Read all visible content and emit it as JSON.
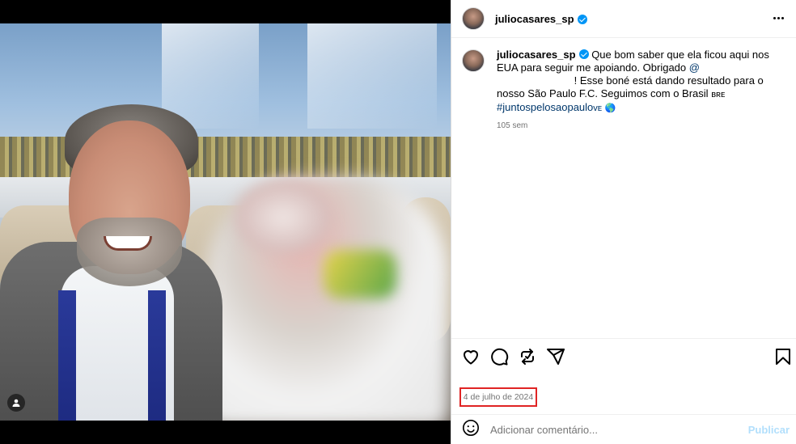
{
  "post": {
    "username": "juliocasares_sp",
    "verified": true,
    "caption": {
      "username": "juliocasares_sp",
      "text_before_mention": "Que bom saber que ela ficou aqui nos EUA para seguir me apoiando. Obrigado ",
      "mention": "@",
      "text_after_mention": "! Esse boné está dando resultado para o nosso São Paulo F.C. Seguimos com o Brasil ",
      "flag_text": "ʙʀᴇ",
      "hashtag": "#juntospelosaopaulo",
      "hashtag_suffix": "ᴠᴇ",
      "emoji": "🌎"
    },
    "time_ago": "105 sem",
    "date": "4 de julho de 2024"
  },
  "icons": {
    "like": "heart-icon",
    "comment": "comment-icon",
    "share": "repost-icon",
    "send": "send-icon",
    "save": "bookmark-icon",
    "emoji": "emoji-icon",
    "more": "more-icon",
    "tag": "user-tag-icon"
  },
  "comment_box": {
    "placeholder": "Adicionar comentário...",
    "publish_label": "Publicar"
  },
  "colors": {
    "verified": "#0095f6",
    "link": "#00376b",
    "highlight_box": "#e02424",
    "publish_disabled": "#b2dffc"
  }
}
